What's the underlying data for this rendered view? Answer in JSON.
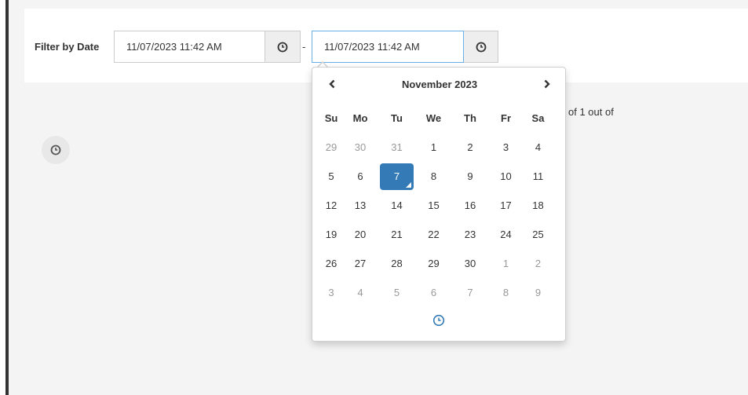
{
  "filter": {
    "label": "Filter by Date",
    "start": {
      "value": "11/07/2023 11:42 AM",
      "button_icon": "clock-icon"
    },
    "separator": "-",
    "end": {
      "value": "11/07/2023 11:42 AM",
      "button_icon": "clock-icon"
    }
  },
  "pagination_text": "of 1 out of",
  "side_button_icon": "clock-icon",
  "calendar": {
    "month_label": "November 2023",
    "prev_icon": "chevron-left-icon",
    "next_icon": "chevron-right-icon",
    "weekdays": [
      "Su",
      "Mo",
      "Tu",
      "We",
      "Th",
      "Fr",
      "Sa"
    ],
    "weeks": [
      [
        {
          "d": "29",
          "muted": true
        },
        {
          "d": "30",
          "muted": true
        },
        {
          "d": "31",
          "muted": true
        },
        {
          "d": "1",
          "muted": false
        },
        {
          "d": "2",
          "muted": false
        },
        {
          "d": "3",
          "muted": false
        },
        {
          "d": "4",
          "muted": false
        }
      ],
      [
        {
          "d": "5",
          "muted": false
        },
        {
          "d": "6",
          "muted": false
        },
        {
          "d": "7",
          "muted": false,
          "active": true
        },
        {
          "d": "8",
          "muted": false
        },
        {
          "d": "9",
          "muted": false
        },
        {
          "d": "10",
          "muted": false
        },
        {
          "d": "11",
          "muted": false
        }
      ],
      [
        {
          "d": "12",
          "muted": false
        },
        {
          "d": "13",
          "muted": false
        },
        {
          "d": "14",
          "muted": false
        },
        {
          "d": "15",
          "muted": false
        },
        {
          "d": "16",
          "muted": false
        },
        {
          "d": "17",
          "muted": false
        },
        {
          "d": "18",
          "muted": false
        }
      ],
      [
        {
          "d": "19",
          "muted": false
        },
        {
          "d": "20",
          "muted": false
        },
        {
          "d": "21",
          "muted": false
        },
        {
          "d": "22",
          "muted": false
        },
        {
          "d": "23",
          "muted": false
        },
        {
          "d": "24",
          "muted": false
        },
        {
          "d": "25",
          "muted": false
        }
      ],
      [
        {
          "d": "26",
          "muted": false
        },
        {
          "d": "27",
          "muted": false
        },
        {
          "d": "28",
          "muted": false
        },
        {
          "d": "29",
          "muted": false
        },
        {
          "d": "30",
          "muted": false
        },
        {
          "d": "1",
          "muted": true
        },
        {
          "d": "2",
          "muted": true
        }
      ],
      [
        {
          "d": "3",
          "muted": true
        },
        {
          "d": "4",
          "muted": true
        },
        {
          "d": "5",
          "muted": true
        },
        {
          "d": "6",
          "muted": true
        },
        {
          "d": "7",
          "muted": true
        },
        {
          "d": "8",
          "muted": true
        },
        {
          "d": "9",
          "muted": true
        }
      ]
    ],
    "footer_icon": "clock-icon"
  },
  "colors": {
    "accent": "#337ab7",
    "focus_border": "#66afe9",
    "muted_text": "#999999"
  }
}
